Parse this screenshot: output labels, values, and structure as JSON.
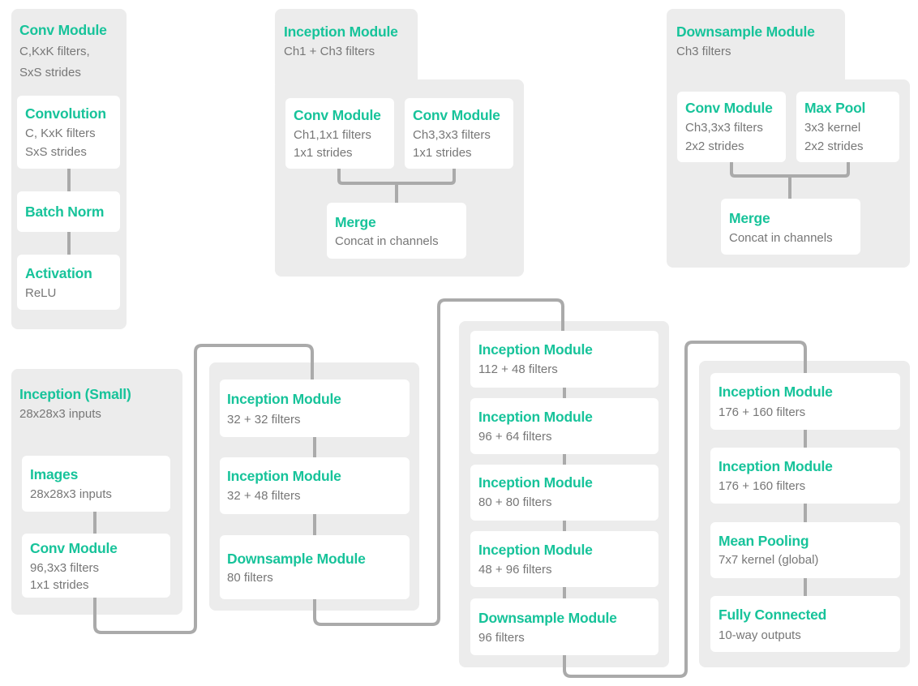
{
  "colors": {
    "accent": "#17c39a",
    "panel": "#ececec",
    "card": "#ffffff",
    "text": "#777777",
    "connector": "#aaaaaa"
  },
  "conv_def": {
    "title": "Conv Module",
    "desc": [
      "C,KxK filters,",
      "SxS strides"
    ],
    "convolution": {
      "title": "Convolution",
      "lines": [
        "C, KxK filters",
        "SxS strides"
      ]
    },
    "batchnorm": {
      "title": "Batch Norm"
    },
    "activation": {
      "title": "Activation",
      "lines": [
        "ReLU"
      ]
    }
  },
  "inception_def": {
    "title": "Inception Module",
    "desc": "Ch1 + Ch3 filters",
    "conv1": {
      "title": "Conv Module",
      "lines": [
        "Ch1,1x1 filters",
        "1x1 strides"
      ]
    },
    "conv3": {
      "title": "Conv Module",
      "lines": [
        "Ch3,3x3 filters",
        "1x1 strides"
      ]
    },
    "merge": {
      "title": "Merge",
      "lines": [
        "Concat in channels"
      ]
    }
  },
  "downsample_def": {
    "title": "Downsample Module",
    "desc": "Ch3 filters",
    "conv": {
      "title": "Conv Module",
      "lines": [
        "Ch3,3x3 filters",
        "2x2 strides"
      ]
    },
    "pool": {
      "title": "Max Pool",
      "lines": [
        "3x3 kernel",
        "2x2 strides"
      ]
    },
    "merge": {
      "title": "Merge",
      "lines": [
        "Concat in channels"
      ]
    }
  },
  "network": {
    "title": "Inception (Small)",
    "desc": "28x28x3 inputs",
    "col1": [
      {
        "title": "Images",
        "lines": [
          "28x28x3 inputs"
        ]
      },
      {
        "title": "Conv Module",
        "lines": [
          "96,3x3 filters",
          "1x1 strides"
        ]
      }
    ],
    "col2": [
      {
        "title": "Inception Module",
        "lines": [
          "32 + 32 filters"
        ]
      },
      {
        "title": "Inception Module",
        "lines": [
          "32 + 48 filters"
        ]
      },
      {
        "title": "Downsample Module",
        "lines": [
          "80 filters"
        ]
      }
    ],
    "col3": [
      {
        "title": "Inception Module",
        "lines": [
          "112 + 48 filters"
        ]
      },
      {
        "title": "Inception Module",
        "lines": [
          "96 + 64 filters"
        ]
      },
      {
        "title": "Inception Module",
        "lines": [
          "80 + 80 filters"
        ]
      },
      {
        "title": "Inception Module",
        "lines": [
          "48 + 96 filters"
        ]
      },
      {
        "title": "Downsample Module",
        "lines": [
          "96 filters"
        ]
      }
    ],
    "col4": [
      {
        "title": "Inception Module",
        "lines": [
          "176 + 160 filters"
        ]
      },
      {
        "title": "Inception Module",
        "lines": [
          "176 + 160 filters"
        ]
      },
      {
        "title": "Mean Pooling",
        "lines": [
          "7x7 kernel (global)"
        ]
      },
      {
        "title": "Fully Connected",
        "lines": [
          "10-way outputs"
        ]
      }
    ]
  }
}
